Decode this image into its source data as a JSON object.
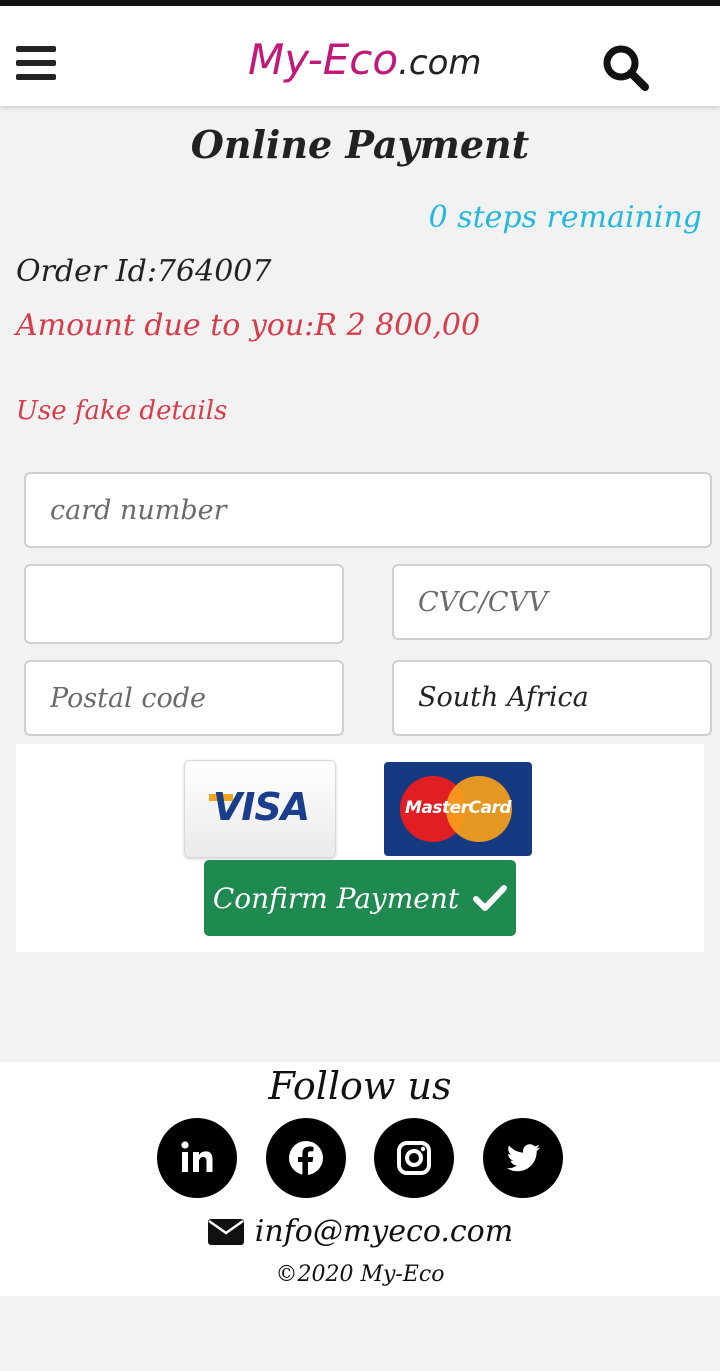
{
  "header": {
    "brand": "My-Eco",
    "tld": ".com",
    "menu_icon": "hamburger-menu-icon",
    "search_icon": "search-icon",
    "brand_color": "#c2187a"
  },
  "main": {
    "title": "Online Payment",
    "steps_remaining": "0 steps remaining",
    "order_id": "Order Id:764007",
    "amount_due": "Amount due to you:R 2 800,00",
    "fake_details_note": "Use fake details"
  },
  "form": {
    "card_number": {
      "value": "",
      "placeholder": "card number"
    },
    "expiry": {
      "value": "",
      "placeholder": ""
    },
    "cvc": {
      "value": "",
      "placeholder": "CVC/CVV"
    },
    "postal_code": {
      "value": "",
      "placeholder": "Postal code"
    },
    "country": "South Africa"
  },
  "payment": {
    "visa_label": "VISA",
    "mastercard_label": "MasterCard",
    "confirm_label": "Confirm Payment",
    "confirm_color": "#1e8a50"
  },
  "footer": {
    "follow_title": "Follow us",
    "social": [
      "linkedin-icon",
      "facebook-icon",
      "instagram-icon",
      "twitter-icon"
    ],
    "email": "info@myeco.com",
    "copyright": "©2020 My-Eco"
  },
  "colors": {
    "steps": "#23b8de",
    "amount": "#d63c4a"
  }
}
